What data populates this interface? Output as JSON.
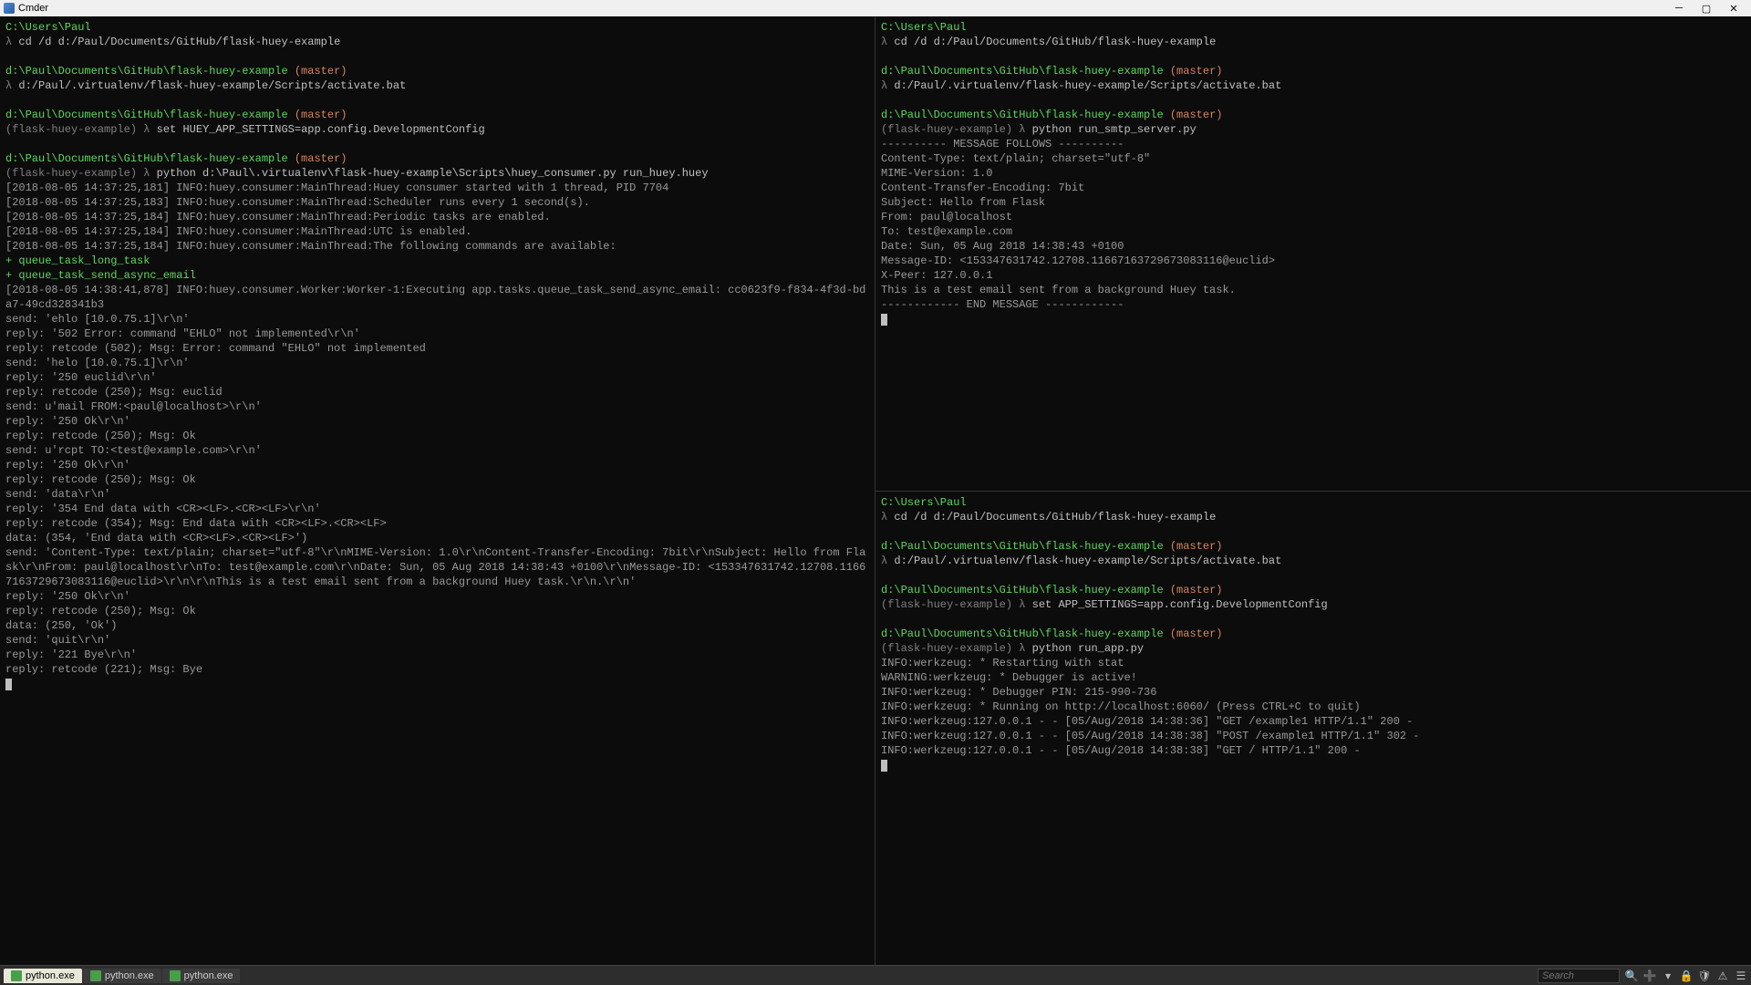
{
  "titlebar": {
    "title": "Cmder"
  },
  "tabs": [
    {
      "label": "python.exe"
    },
    {
      "label": "python.exe"
    },
    {
      "label": "python.exe"
    }
  ],
  "search_placeholder": "Search",
  "pane_left": {
    "blocks": [
      {
        "path": "C:\\Users\\Paul",
        "cmd": "cd /d d:/Paul/Documents/GitHub/flask-huey-example"
      },
      {
        "path": "d:\\Paul\\Documents\\GitHub\\flask-huey-example",
        "branch": "(master)",
        "cmd": "d:/Paul/.virtualenv/flask-huey-example/Scripts/activate.bat"
      },
      {
        "path": "d:\\Paul\\Documents\\GitHub\\flask-huey-example",
        "branch": "(master)",
        "venv": "(flask-huey-example)",
        "cmd": "set HUEY_APP_SETTINGS=app.config.DevelopmentConfig"
      },
      {
        "path": "d:\\Paul\\Documents\\GitHub\\flask-huey-example",
        "branch": "(master)",
        "venv": "(flask-huey-example)",
        "cmd": "python d:\\Paul\\.virtualenv\\flask-huey-example\\Scripts\\huey_consumer.py run_huey.huey"
      }
    ],
    "output": [
      "[2018-08-05 14:37:25,181] INFO:huey.consumer:MainThread:Huey consumer started with 1 thread, PID 7704",
      "[2018-08-05 14:37:25,183] INFO:huey.consumer:MainThread:Scheduler runs every 1 second(s).",
      "[2018-08-05 14:37:25,184] INFO:huey.consumer:MainThread:Periodic tasks are enabled.",
      "[2018-08-05 14:37:25,184] INFO:huey.consumer:MainThread:UTC is enabled.",
      "[2018-08-05 14:37:25,184] INFO:huey.consumer:MainThread:The following commands are available:"
    ],
    "plus_lines": [
      "+ queue_task_long_task",
      "+ queue_task_send_async_email"
    ],
    "output2": [
      "[2018-08-05 14:38:41,878] INFO:huey.consumer.Worker:Worker-1:Executing app.tasks.queue_task_send_async_email: cc0623f9-f834-4f3d-bda7-49cd328341b3",
      "send: 'ehlo [10.0.75.1]\\r\\n'",
      "reply: '502 Error: command \"EHLO\" not implemented\\r\\n'",
      "reply: retcode (502); Msg: Error: command \"EHLO\" not implemented",
      "send: 'helo [10.0.75.1]\\r\\n'",
      "reply: '250 euclid\\r\\n'",
      "reply: retcode (250); Msg: euclid",
      "send: u'mail FROM:<paul@localhost>\\r\\n'",
      "reply: '250 Ok\\r\\n'",
      "reply: retcode (250); Msg: Ok",
      "send: u'rcpt TO:<test@example.com>\\r\\n'",
      "reply: '250 Ok\\r\\n'",
      "reply: retcode (250); Msg: Ok",
      "send: 'data\\r\\n'",
      "reply: '354 End data with <CR><LF>.<CR><LF>\\r\\n'",
      "reply: retcode (354); Msg: End data with <CR><LF>.<CR><LF>",
      "data: (354, 'End data with <CR><LF>.<CR><LF>')",
      "send: 'Content-Type: text/plain; charset=\"utf-8\"\\r\\nMIME-Version: 1.0\\r\\nContent-Transfer-Encoding: 7bit\\r\\nSubject: Hello from Flask\\r\\nFrom: paul@localhost\\r\\nTo: test@example.com\\r\\nDate: Sun, 05 Aug 2018 14:38:43 +0100\\r\\nMessage-ID: <153347631742.12708.11667163729673083116@euclid>\\r\\n\\r\\nThis is a test email sent from a background Huey task.\\r\\n.\\r\\n'",
      "reply: '250 Ok\\r\\n'",
      "reply: retcode (250); Msg: Ok",
      "data: (250, 'Ok')",
      "send: 'quit\\r\\n'",
      "reply: '221 Bye\\r\\n'",
      "reply: retcode (221); Msg: Bye"
    ]
  },
  "pane_top": {
    "blocks": [
      {
        "path": "C:\\Users\\Paul",
        "cmd": "cd /d d:/Paul/Documents/GitHub/flask-huey-example"
      },
      {
        "path": "d:\\Paul\\Documents\\GitHub\\flask-huey-example",
        "branch": "(master)",
        "cmd": "d:/Paul/.virtualenv/flask-huey-example/Scripts/activate.bat"
      },
      {
        "path": "d:\\Paul\\Documents\\GitHub\\flask-huey-example",
        "branch": "(master)",
        "venv": "(flask-huey-example)",
        "cmd": "python run_smtp_server.py"
      }
    ],
    "output": [
      "---------- MESSAGE FOLLOWS ----------",
      "Content-Type: text/plain; charset=\"utf-8\"",
      "MIME-Version: 1.0",
      "Content-Transfer-Encoding: 7bit",
      "Subject: Hello from Flask",
      "From: paul@localhost",
      "To: test@example.com",
      "Date: Sun, 05 Aug 2018 14:38:43 +0100",
      "Message-ID: <153347631742.12708.11667163729673083116@euclid>",
      "X-Peer: 127.0.0.1",
      "",
      "This is a test email sent from a background Huey task.",
      "------------ END MESSAGE ------------"
    ]
  },
  "pane_bottom": {
    "blocks": [
      {
        "path": "C:\\Users\\Paul",
        "cmd": "cd /d d:/Paul/Documents/GitHub/flask-huey-example"
      },
      {
        "path": "d:\\Paul\\Documents\\GitHub\\flask-huey-example",
        "branch": "(master)",
        "cmd": "d:/Paul/.virtualenv/flask-huey-example/Scripts/activate.bat"
      },
      {
        "path": "d:\\Paul\\Documents\\GitHub\\flask-huey-example",
        "branch": "(master)",
        "venv": "(flask-huey-example)",
        "cmd": "set APP_SETTINGS=app.config.DevelopmentConfig"
      },
      {
        "path": "d:\\Paul\\Documents\\GitHub\\flask-huey-example",
        "branch": "(master)",
        "venv": "(flask-huey-example)",
        "cmd": "python run_app.py"
      }
    ],
    "output": [
      "INFO:werkzeug: * Restarting with stat",
      "WARNING:werkzeug: * Debugger is active!",
      "INFO:werkzeug: * Debugger PIN: 215-990-736",
      "INFO:werkzeug: * Running on http://localhost:6060/ (Press CTRL+C to quit)",
      "INFO:werkzeug:127.0.0.1 - - [05/Aug/2018 14:38:36] \"GET /example1 HTTP/1.1\" 200 -",
      "INFO:werkzeug:127.0.0.1 - - [05/Aug/2018 14:38:38] \"POST /example1 HTTP/1.1\" 302 -",
      "INFO:werkzeug:127.0.0.1 - - [05/Aug/2018 14:38:38] \"GET / HTTP/1.1\" 200 -"
    ]
  }
}
